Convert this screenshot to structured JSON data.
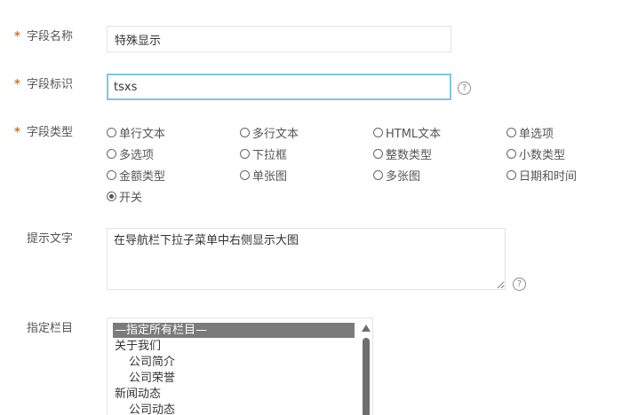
{
  "form": {
    "field_name": {
      "required_mark": "*",
      "label": "字段名称",
      "value": "特殊显示"
    },
    "field_id": {
      "required_mark": "*",
      "label": "字段标识",
      "value": "tsxs",
      "help_symbol": "?"
    },
    "field_type": {
      "required_mark": "*",
      "label": "字段类型",
      "options": [
        {
          "label": "单行文本",
          "checked": false
        },
        {
          "label": "多行文本",
          "checked": false
        },
        {
          "label": "HTML文本",
          "checked": false
        },
        {
          "label": "单选项",
          "checked": false
        },
        {
          "label": "多选项",
          "checked": false
        },
        {
          "label": "下拉框",
          "checked": false
        },
        {
          "label": "整数类型",
          "checked": false
        },
        {
          "label": "小数类型",
          "checked": false
        },
        {
          "label": "金额类型",
          "checked": false
        },
        {
          "label": "单张图",
          "checked": false
        },
        {
          "label": "多张图",
          "checked": false
        },
        {
          "label": "日期和时间",
          "checked": false
        },
        {
          "label": "开关",
          "checked": true
        }
      ]
    },
    "hint_text": {
      "label": "提示文字",
      "value": "在导航栏下拉子菜单中右侧显示大图",
      "help_symbol": "?"
    },
    "column": {
      "label": "指定栏目",
      "options": [
        {
          "label": "—指定所有栏目—",
          "selected": true
        },
        {
          "label": "关于我们",
          "selected": false
        },
        {
          "label": "公司简介",
          "selected": false
        },
        {
          "label": "公司荣誉",
          "selected": false
        },
        {
          "label": "新闻动态",
          "selected": false
        },
        {
          "label": "公司动态",
          "selected": false
        }
      ]
    }
  },
  "colors": {
    "required": "#e06c1a",
    "focus_border": "#7fc6e6",
    "selected_option_bg": "#7b7b7b"
  }
}
